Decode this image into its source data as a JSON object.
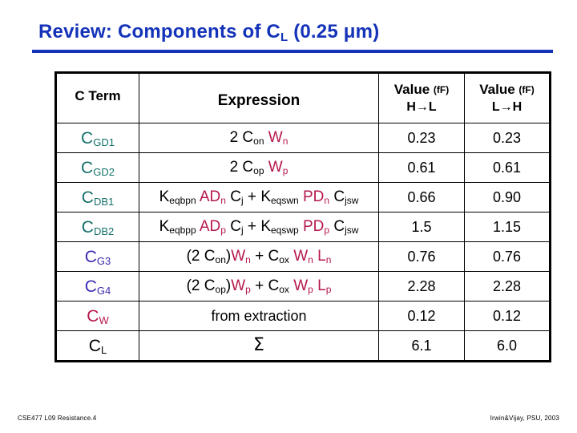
{
  "slide": {
    "title_main": "Review:  Components of C",
    "title_sub": "L",
    "title_tail": " (0.25 μm)",
    "accent_color": "#1433b9"
  },
  "table": {
    "headers": {
      "term": "C Term",
      "expression": "Expression",
      "value1_label": "Value",
      "value1_unit": "(fF)",
      "value1_dir": "H→L",
      "value2_label": "Value",
      "value2_unit": "(fF)",
      "value2_dir": "L→H"
    },
    "rows": [
      {
        "term_base": "C",
        "term_sub": "GD1",
        "term_color": "#14706a",
        "expression_text": "2 Con Wn",
        "value_hl": "0.23",
        "value_lh": "0.23"
      },
      {
        "term_base": "C",
        "term_sub": "GD2",
        "term_color": "#14706a",
        "expression_text": "2 Cop Wp",
        "value_hl": "0.61",
        "value_lh": "0.61"
      },
      {
        "term_base": "C",
        "term_sub": "DB1",
        "term_color": "#14706a",
        "expression_text": "Keqbpn ADn Cj + Keqswn PDn Cjsw",
        "value_hl": "0.66",
        "value_lh": "0.90"
      },
      {
        "term_base": "C",
        "term_sub": "DB2",
        "term_color": "#14706a",
        "expression_text": "Keqbpp ADp Cj + Keqswp PDp Cjsw",
        "value_hl": "1.5",
        "value_lh": "1.15"
      },
      {
        "term_base": "C",
        "term_sub": "G3",
        "term_color": "#3b2bb3",
        "expression_text": "(2 Con)Wn + Cox Wn Ln",
        "value_hl": "0.76",
        "value_lh": "0.76"
      },
      {
        "term_base": "C",
        "term_sub": "G4",
        "term_color": "#3b2bb3",
        "expression_text": "(2 Cop)Wp + Cox Wp Lp",
        "value_hl": "2.28",
        "value_lh": "2.28"
      },
      {
        "term_base": "C",
        "term_sub": "W",
        "term_color": "#b5184a",
        "expression_text": "from extraction",
        "value_hl": "0.12",
        "value_lh": "0.12"
      },
      {
        "term_base": "C",
        "term_sub": "L",
        "term_color": "#000000",
        "expression_text": "Σ",
        "value_hl": "6.1",
        "value_lh": "6.0"
      }
    ]
  },
  "footer": {
    "left": "CSE477 L09 Resistance.4",
    "right": "Irwin&Vijay, PSU, 2003"
  }
}
